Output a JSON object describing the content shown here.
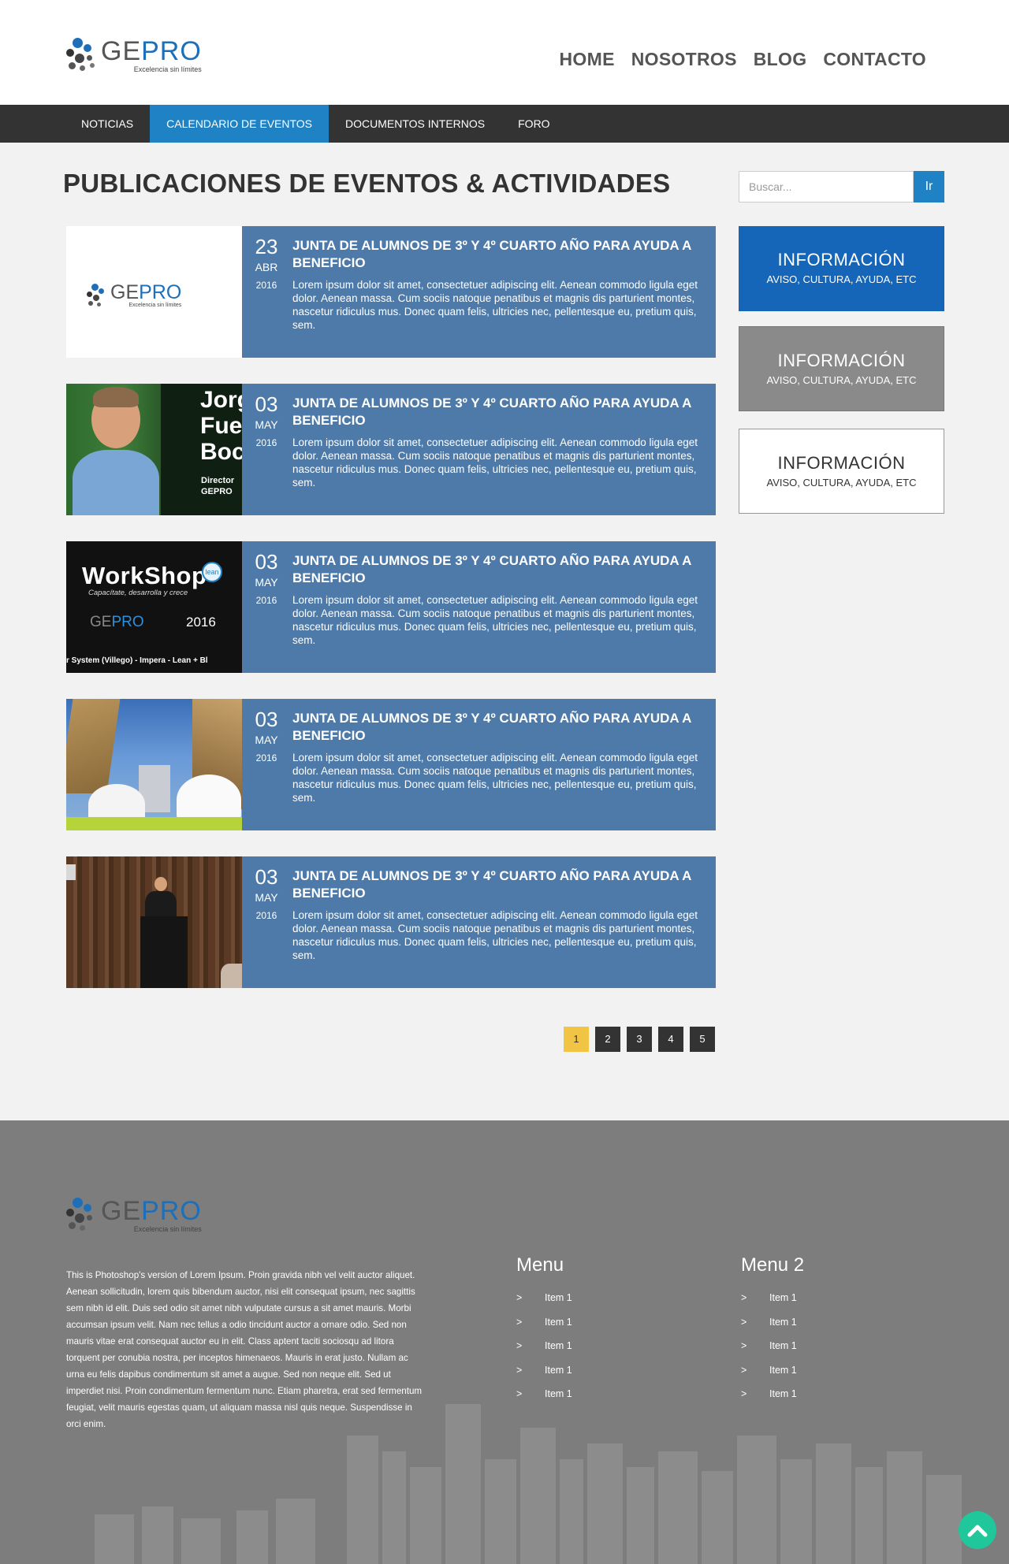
{
  "brand": {
    "name_gray": "GE",
    "name_blue": "PRO",
    "tagline": "Excelencia sin límites"
  },
  "top_nav": [
    "HOME",
    "NOSOTROS",
    "BLOG",
    "CONTACTO"
  ],
  "sub_nav": {
    "items": [
      "NOTICIAS",
      "CALENDARIO DE EVENTOS",
      "DOCUMENTOS INTERNOS",
      "FORO"
    ],
    "active": "CALENDARIO DE EVENTOS"
  },
  "page_title": "PUBLICACIONES DE EVENTOS & ACTIVIDADES",
  "search": {
    "placeholder": "Buscar...",
    "button": "Ir"
  },
  "posts": [
    {
      "day": "23",
      "month": "ABR",
      "year": "2016",
      "title": "JUNTA DE ALUMNOS DE 3º Y 4º CUARTO AÑO PARA AYUDA A BENEFICIO",
      "excerpt": "Lorem ipsum dolor sit amet, consectetuer adipiscing elit. Aenean commodo ligula eget dolor. Aenean massa. Cum sociis natoque penatibus et magnis dis parturient montes, nascetur ridiculus mus. Donec quam felis, ultricies nec, pellentesque eu, pretium quis, sem.",
      "image": "gepro-logo"
    },
    {
      "day": "03",
      "month": "MAY",
      "year": "2016",
      "title": "JUNTA DE ALUMNOS DE 3º Y 4º CUARTO AÑO PARA AYUDA A BENEFICIO",
      "excerpt": "Lorem ipsum dolor sit amet, consectetuer adipiscing elit. Aenean commodo ligula eget dolor. Aenean massa. Cum sociis natoque penatibus et magnis dis parturient montes, nascetur ridiculus mus. Donec quam felis, ultricies nec, pellentesque eu, pretium quis, sem.",
      "image": "director-portrait",
      "image_text": [
        "Jorg",
        "Fue",
        "Boc"
      ],
      "image_role": [
        "Director",
        "GEPRO"
      ]
    },
    {
      "day": "03",
      "month": "MAY",
      "year": "2016",
      "title": "JUNTA DE ALUMNOS DE 3º Y 4º CUARTO AÑO PARA AYUDA A BENEFICIO",
      "excerpt": "Lorem ipsum dolor sit amet, consectetuer adipiscing elit. Aenean commodo ligula eget dolor. Aenean massa. Cum sociis natoque penatibus et magnis dis parturient montes, nascetur ridiculus mus. Donec quam felis, ultricies nec, pellentesque eu, pretium quis, sem.",
      "image": "workshop-banner",
      "image_text": [
        "WorkShop",
        "Capacítate, desarrolla y crece",
        "2016",
        "r System (Villego) - Impera - Lean + Bl",
        "lean"
      ]
    },
    {
      "day": "03",
      "month": "MAY",
      "year": "2016",
      "title": "JUNTA DE ALUMNOS DE 3º Y 4º CUARTO AÑO PARA AYUDA A BENEFICIO",
      "excerpt": "Lorem ipsum dolor sit amet, consectetuer adipiscing elit. Aenean commodo ligula eget dolor. Aenean massa. Cum sociis natoque penatibus et magnis dis parturient montes, nascetur ridiculus mus. Donec quam felis, ultricies nec, pellentesque eu, pretium quis, sem.",
      "image": "construction-helmets"
    },
    {
      "day": "03",
      "month": "MAY",
      "year": "2016",
      "title": "JUNTA DE ALUMNOS DE 3º Y 4º CUARTO AÑO PARA AYUDA A BENEFICIO",
      "excerpt": "Lorem ipsum dolor sit amet, consectetuer adipiscing elit. Aenean commodo ligula eget dolor. Aenean massa. Cum sociis natoque penatibus et magnis dis parturient montes, nascetur ridiculus mus. Donec quam felis, ultricies nec, pellentesque eu, pretium quis, sem.",
      "image": "speaker-podium"
    }
  ],
  "pagination": {
    "pages": [
      "1",
      "2",
      "3",
      "4",
      "5"
    ],
    "current": "1"
  },
  "info_boxes": [
    {
      "title": "INFORMACIÓN",
      "subtitle": "AVISO, CULTURA, AYUDA, ETC",
      "bg": "#1565b8",
      "fg": "#ffffff"
    },
    {
      "title": "INFORMACIÓN",
      "subtitle": "AVISO, CULTURA, AYUDA, ETC",
      "bg": "#8a8a8a",
      "fg": "#ffffff"
    },
    {
      "title": "INFORMACIÓN",
      "subtitle": "AVISO, CULTURA, AYUDA, ETC",
      "bg": "#ffffff",
      "fg": "#333333"
    }
  ],
  "footer": {
    "description": "This is Photoshop's version  of Lorem Ipsum. Proin gravida nibh vel velit auctor aliquet. Aenean sollicitudin, lorem quis bibendum auctor, nisi elit consequat ipsum, nec sagittis sem nibh id elit. Duis sed odio sit amet nibh vulputate cursus a sit amet mauris. Morbi accumsan ipsum velit. Nam nec tellus a odio tincidunt auctor a ornare odio. Sed non  mauris vitae erat consequat auctor eu in elit. Class aptent taciti sociosqu ad litora torquent per conubia nostra, per inceptos himenaeos. Mauris in erat justo. Nullam ac urna eu felis dapibus condimentum sit amet a augue. Sed non neque elit. Sed ut imperdiet nisi. Proin condimentum fermentum nunc. Etiam pharetra, erat sed fermentum feugiat, velit mauris egestas quam, ut aliquam massa nisl quis neque. Suspendisse in orci enim.",
    "menus": [
      {
        "title": "Menu",
        "items": [
          "Item 1",
          "Item 1",
          "Item 1",
          "Item 1",
          "Item 1"
        ]
      },
      {
        "title": "Menu 2",
        "items": [
          "Item 1",
          "Item 1",
          "Item 1",
          "Item 1",
          "Item 1"
        ]
      }
    ],
    "bullet": ">"
  },
  "colors": {
    "accent_blue": "#1e82c4",
    "post_bg": "#4d7aa8",
    "pager_current": "#f2c444",
    "to_top": "#1fc79a"
  }
}
